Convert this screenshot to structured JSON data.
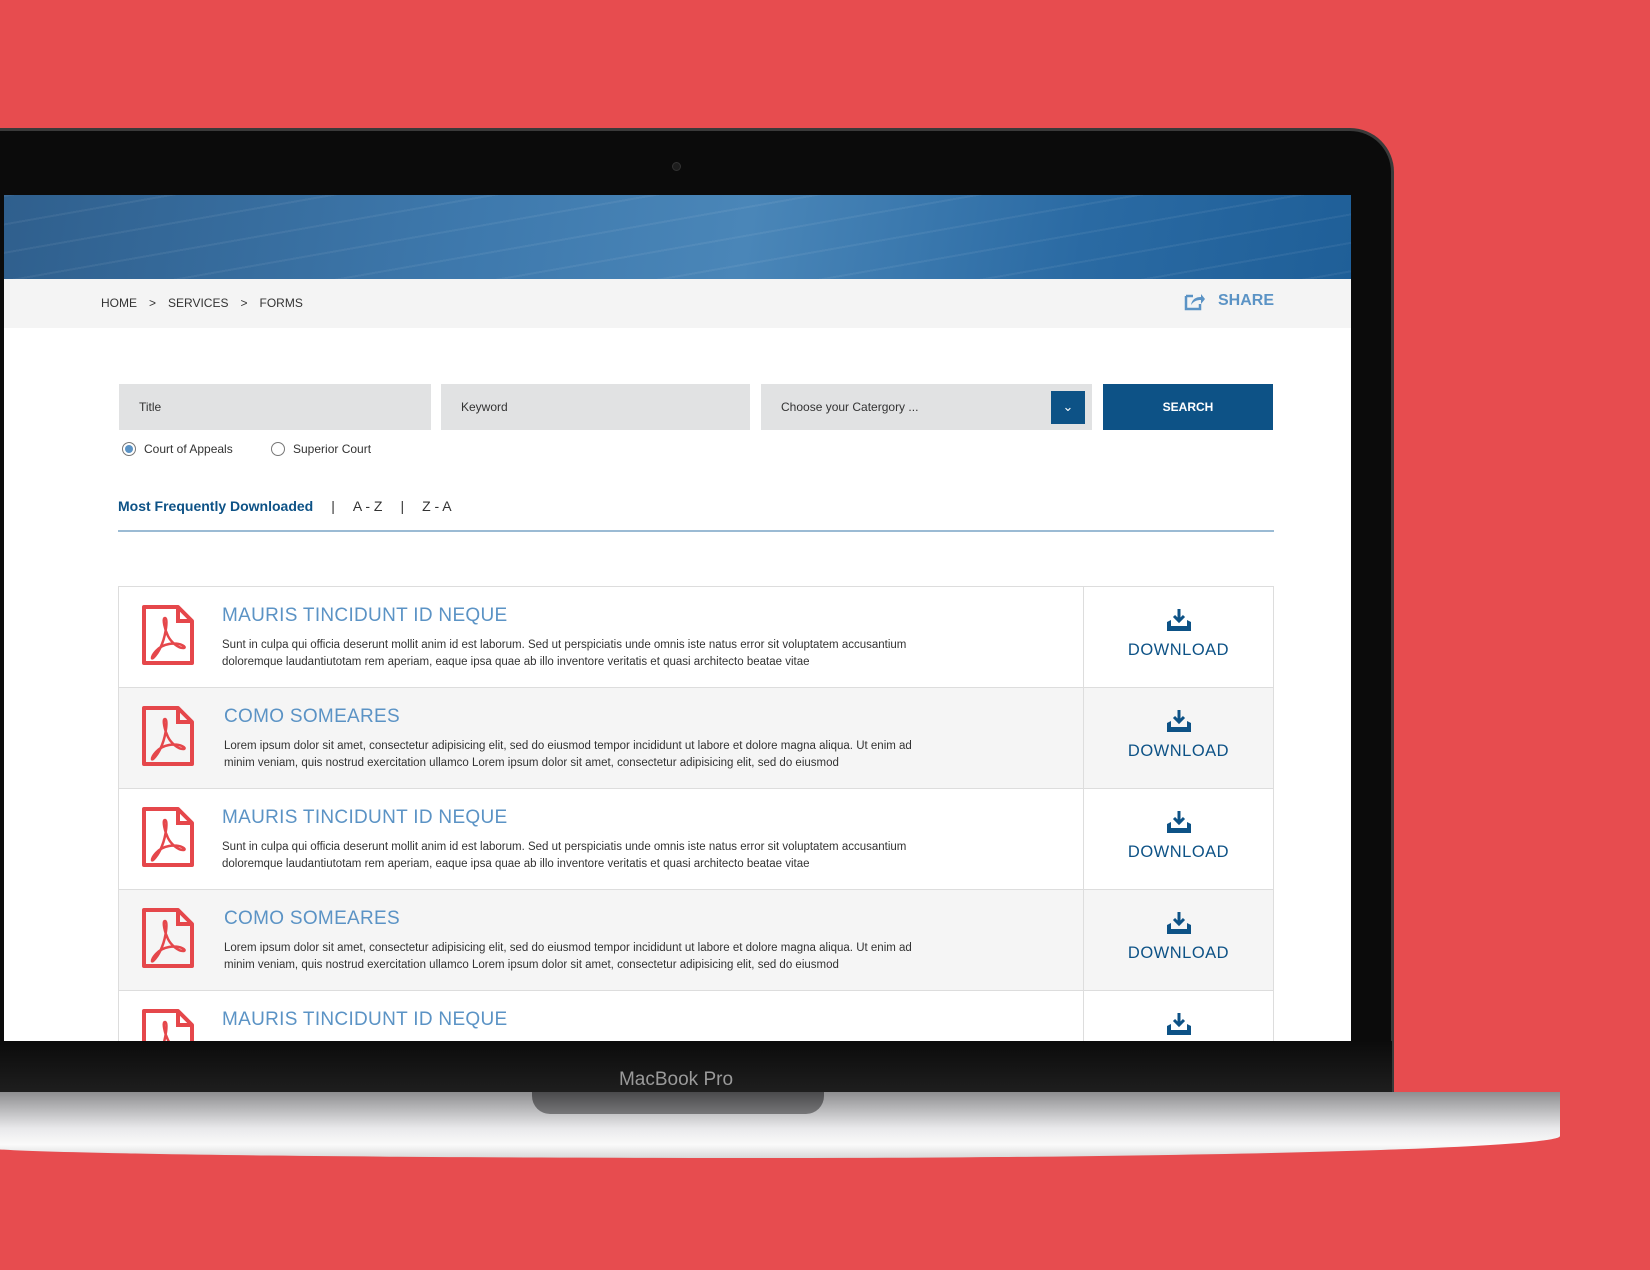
{
  "device": {
    "label": "MacBook Pro"
  },
  "breadcrumb": [
    "HOME",
    ">",
    "SERVICES",
    ">",
    "FORMS"
  ],
  "share": {
    "label": "SHARE",
    "icon": "share-icon"
  },
  "search": {
    "title_placeholder": "Title",
    "keyword_placeholder": "Keyword",
    "category_placeholder": "Choose your Catergory ...",
    "button": "SEARCH"
  },
  "court": {
    "options": [
      "Court of Appeals",
      "Superior Court"
    ],
    "selected": "Court of Appeals"
  },
  "sort": {
    "tabs": [
      "Most Frequently Downloaded",
      "A - Z",
      "Z - A"
    ],
    "separator": "|",
    "active": "Most Frequently Downloaded"
  },
  "colors": {
    "accent": "#0d5286",
    "link": "#5b93c5",
    "pdf": "#e5474b",
    "background": "#e74c4f"
  },
  "forms": [
    {
      "title": "MAURIS TINCIDUNT ID NEQUE",
      "desc": "Sunt in culpa qui officia deserunt mollit anim id est laborum. Sed ut perspiciatis unde omnis iste natus error sit voluptatem accusantium doloremque laudantiutotam rem aperiam, eaque ipsa quae ab illo inventore veritatis et quasi architecto beatae vitae",
      "action": "DOWNLOAD"
    },
    {
      "title": "COMO SOMEARES",
      "desc": "Lorem ipsum dolor sit amet, consectetur adipisicing elit, sed do eiusmod tempor incididunt ut labore et dolore magna aliqua. Ut enim ad minim veniam, quis nostrud exercitation ullamco Lorem ipsum dolor sit amet, consectetur adipisicing elit, sed do eiusmod",
      "action": "DOWNLOAD"
    },
    {
      "title": "MAURIS TINCIDUNT ID NEQUE",
      "desc": "Sunt in culpa qui officia deserunt mollit anim id est laborum. Sed ut perspiciatis unde omnis iste natus error sit voluptatem accusantium doloremque laudantiutotam rem aperiam, eaque ipsa quae ab illo inventore veritatis et quasi architecto beatae vitae",
      "action": "DOWNLOAD"
    },
    {
      "title": "COMO SOMEARES",
      "desc": "Lorem ipsum dolor sit amet, consectetur adipisicing elit, sed do eiusmod tempor incididunt ut labore et dolore magna aliqua. Ut enim ad minim veniam, quis nostrud exercitation ullamco Lorem ipsum dolor sit amet, consectetur adipisicing elit, sed do eiusmod",
      "action": "DOWNLOAD"
    },
    {
      "title": "MAURIS TINCIDUNT ID NEQUE",
      "desc": "",
      "action": ""
    }
  ]
}
